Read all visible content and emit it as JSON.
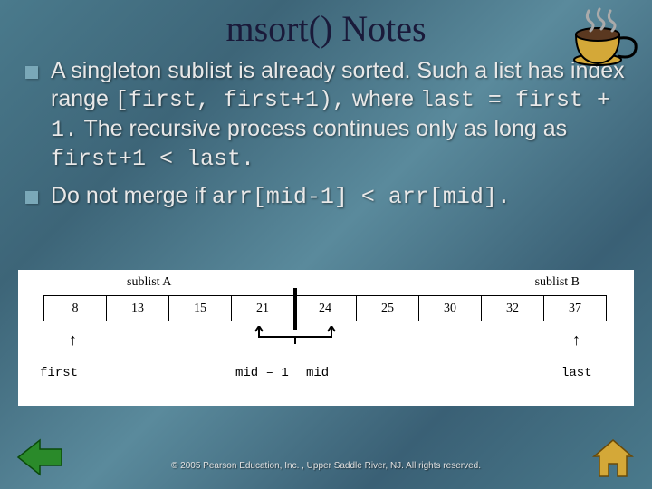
{
  "title": "msort() Notes",
  "bullets": [
    {
      "spans": [
        {
          "t": "A singleton sublist is already sorted. Such a list has index range ",
          "c": false
        },
        {
          "t": "[first, first+1),",
          "c": true
        },
        {
          "t": " where ",
          "c": false
        },
        {
          "t": "last = first + 1.",
          "c": true
        },
        {
          "t": " The recursive process continues only as long as ",
          "c": false
        },
        {
          "t": "first+1 < last.",
          "c": true
        }
      ]
    },
    {
      "spans": [
        {
          "t": "Do not merge if ",
          "c": false
        },
        {
          "t": "arr[mid-1] < arr[mid].",
          "c": true
        }
      ]
    }
  ],
  "diagram": {
    "sublistA": "sublist A",
    "sublistB": "sublist B",
    "values": [
      "8",
      "13",
      "15",
      "21",
      "24",
      "25",
      "30",
      "32",
      "37"
    ],
    "first": "first",
    "midm1": "mid – 1",
    "mid": "mid",
    "last": "last"
  },
  "footer": "© 2005 Pearson Education, Inc. , Upper Saddle River, NJ.  All rights reserved."
}
